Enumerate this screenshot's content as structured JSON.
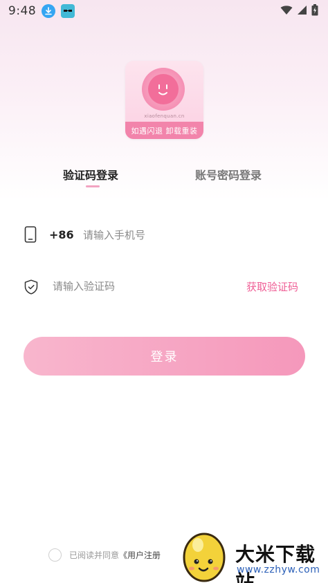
{
  "status_bar": {
    "time": "9:48"
  },
  "logo": {
    "site_text": "xiaofenquan.cn",
    "band_text": "如遇闪退 卸载重装"
  },
  "tabs": [
    {
      "label": "验证码登录",
      "active": true
    },
    {
      "label": "账号密码登录",
      "active": false
    }
  ],
  "form": {
    "country_code": "+86",
    "phone_placeholder": "请输入手机号",
    "code_placeholder": "请输入验证码",
    "get_code_label": "获取验证码"
  },
  "login_button": {
    "label": "登录"
  },
  "agreement": {
    "prefix": "已阅读并同意",
    "link": "《用户注册"
  },
  "watermark": {
    "title": "大米下载站",
    "url": "www.zzhyw.com"
  },
  "colors": {
    "accent": "#ef5e95",
    "button_start": "#f8b6cd",
    "button_end": "#f598bb",
    "tab_underline": "#f2a3c2"
  }
}
